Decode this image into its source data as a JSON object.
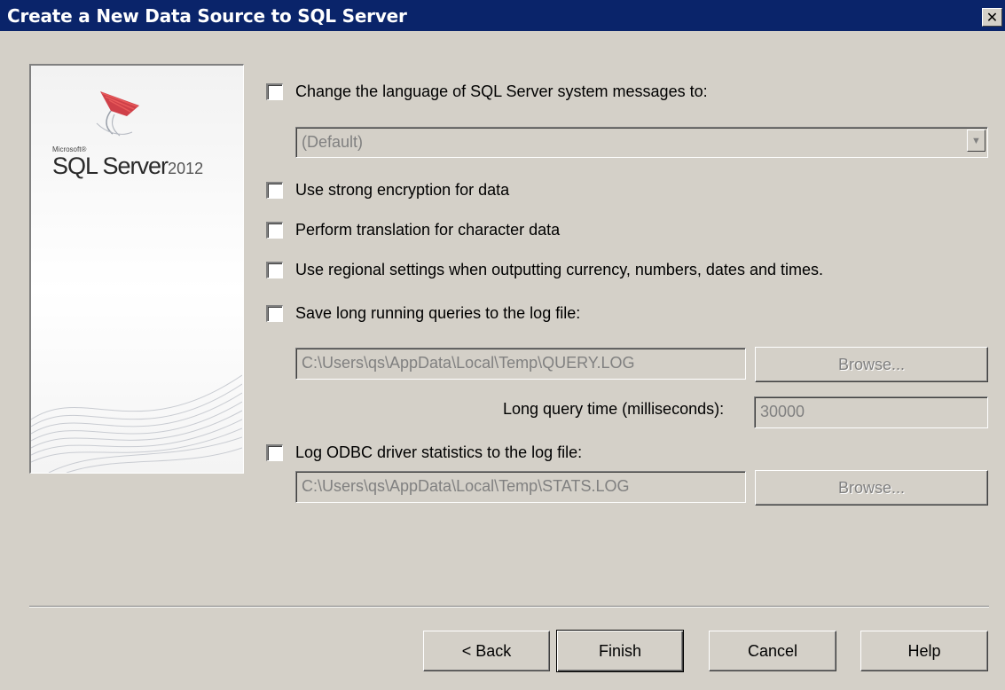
{
  "window": {
    "title": "Create a New Data Source to SQL Server",
    "close_glyph": "✕"
  },
  "logo": {
    "company": "Microsoft®",
    "product": "SQL Server",
    "year": "2012",
    "icon": "sql-server-logo-icon"
  },
  "options": {
    "change_language": {
      "label": "Change the language of SQL Server system messages to:",
      "checked": false
    },
    "language_select": {
      "value": "(Default)"
    },
    "strong_encryption": {
      "label": "Use strong encryption for data",
      "checked": false
    },
    "translate_char": {
      "label": "Perform translation for character data",
      "checked": false
    },
    "regional_settings": {
      "label": "Use regional settings when outputting currency, numbers, dates and times.",
      "checked": false
    },
    "save_long_queries": {
      "label": "Save long running queries to the log file:",
      "checked": false
    },
    "query_log_path": "C:\\Users\\qs\\AppData\\Local\\Temp\\QUERY.LOG",
    "browse_label": "Browse...",
    "long_query_time_label": "Long query time (milliseconds):",
    "long_query_time_value": "30000",
    "log_odbc_stats": {
      "label": "Log ODBC driver statistics to the log file:",
      "checked": false
    },
    "stats_log_path": "C:\\Users\\qs\\AppData\\Local\\Temp\\STATS.LOG"
  },
  "buttons": {
    "back": "< Back",
    "finish": "Finish",
    "cancel": "Cancel",
    "help": "Help"
  },
  "colors": {
    "title_bar": "#0a246a",
    "dialog_bg": "#d4d0c8",
    "disabled_text": "#808080",
    "logo_red": "#c8202a"
  }
}
